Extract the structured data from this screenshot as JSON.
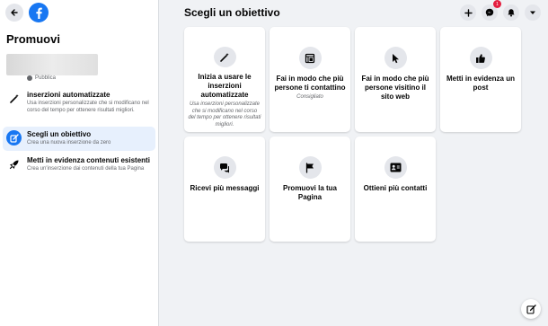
{
  "sidebar": {
    "title": "Promuovi",
    "page_status": "Pubblica",
    "items": [
      {
        "label": "inserzioni automatizzate",
        "desc": "Usa inserzioni personalizzate che si modificano nel corso del tempo per ottenere risultati migliori."
      },
      {
        "label": "Scegli un obiettivo",
        "desc": "Crea una nuova inserzione da zero"
      },
      {
        "label": "Metti in evidenza contenuti esistenti",
        "desc": "Crea un'inserzione dai contenuti della tua Pagina"
      }
    ]
  },
  "header": {
    "title": "Scegli un obiettivo",
    "notification_badge": "1"
  },
  "cards": [
    {
      "title": "Inizia a usare le inserzioni automatizzate",
      "subtitle": "Usa inserzioni personalizzate che si modificano nel corso del tempo per ottenere risultati migliori.",
      "icon": "magic-wand-icon"
    },
    {
      "title": "Fai in modo che più persone ti contattino",
      "subtitle": "Consigliato",
      "icon": "messenger-window-icon"
    },
    {
      "title": "Fai in modo che più persone visitino il sito web",
      "subtitle": "",
      "icon": "cursor-icon"
    },
    {
      "title": "Metti in evidenza un post",
      "subtitle": "",
      "icon": "thumbs-up-icon"
    },
    {
      "title": "Ricevi più messaggi",
      "subtitle": "",
      "icon": "chat-bubbles-icon"
    },
    {
      "title": "Promuovi la tua Pagina",
      "subtitle": "",
      "icon": "flag-icon"
    },
    {
      "title": "Ottieni più contatti",
      "subtitle": "",
      "icon": "contact-card-icon"
    }
  ],
  "colors": {
    "brand": "#1877f2",
    "background": "#f0f2f5",
    "active_item": "#e7f0fd",
    "badge": "#e41e3f"
  }
}
